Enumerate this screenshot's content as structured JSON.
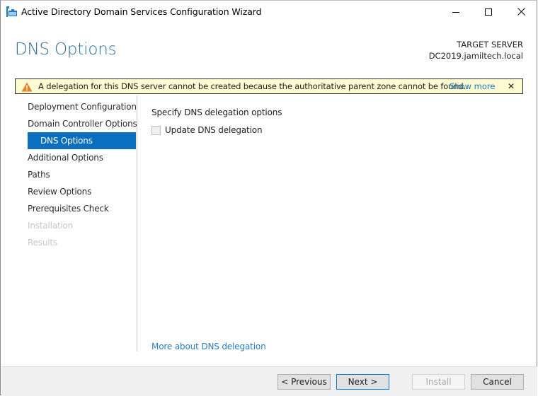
{
  "window": {
    "title": "Active Directory Domain Services Configuration Wizard",
    "controls": {
      "minimize": "minimize",
      "maximize": "maximize",
      "close": "close"
    }
  },
  "header": {
    "page_title": "DNS Options",
    "target_label": "TARGET SERVER",
    "target_server": "DC2019.jamiltech.local"
  },
  "warning": {
    "icon": "warning-triangle-icon",
    "message": "A delegation for this DNS server cannot be created because the authoritative parent zone cannot be found...",
    "show_more": "Show more",
    "close_glyph": "✕"
  },
  "nav": {
    "items": [
      {
        "label": "Deployment Configuration",
        "state": "normal"
      },
      {
        "label": "Domain Controller Options",
        "state": "normal"
      },
      {
        "label": "DNS Options",
        "state": "active"
      },
      {
        "label": "Additional Options",
        "state": "normal"
      },
      {
        "label": "Paths",
        "state": "normal"
      },
      {
        "label": "Review Options",
        "state": "normal"
      },
      {
        "label": "Prerequisites Check",
        "state": "normal"
      },
      {
        "label": "Installation",
        "state": "disabled"
      },
      {
        "label": "Results",
        "state": "disabled"
      }
    ]
  },
  "content": {
    "section_label": "Specify DNS delegation options",
    "checkbox": {
      "label": "Update DNS delegation",
      "checked": false,
      "enabled": false
    },
    "help_link": "More about DNS delegation"
  },
  "footer": {
    "previous": "< Previous",
    "next": "Next >",
    "install": "Install",
    "cancel": "Cancel"
  },
  "colors": {
    "accent": "#0a6fbf",
    "title": "#2b6f96",
    "link": "#1a76c0",
    "warning_bg": "#fdfbd1",
    "warning_icon": "#e8812a"
  }
}
